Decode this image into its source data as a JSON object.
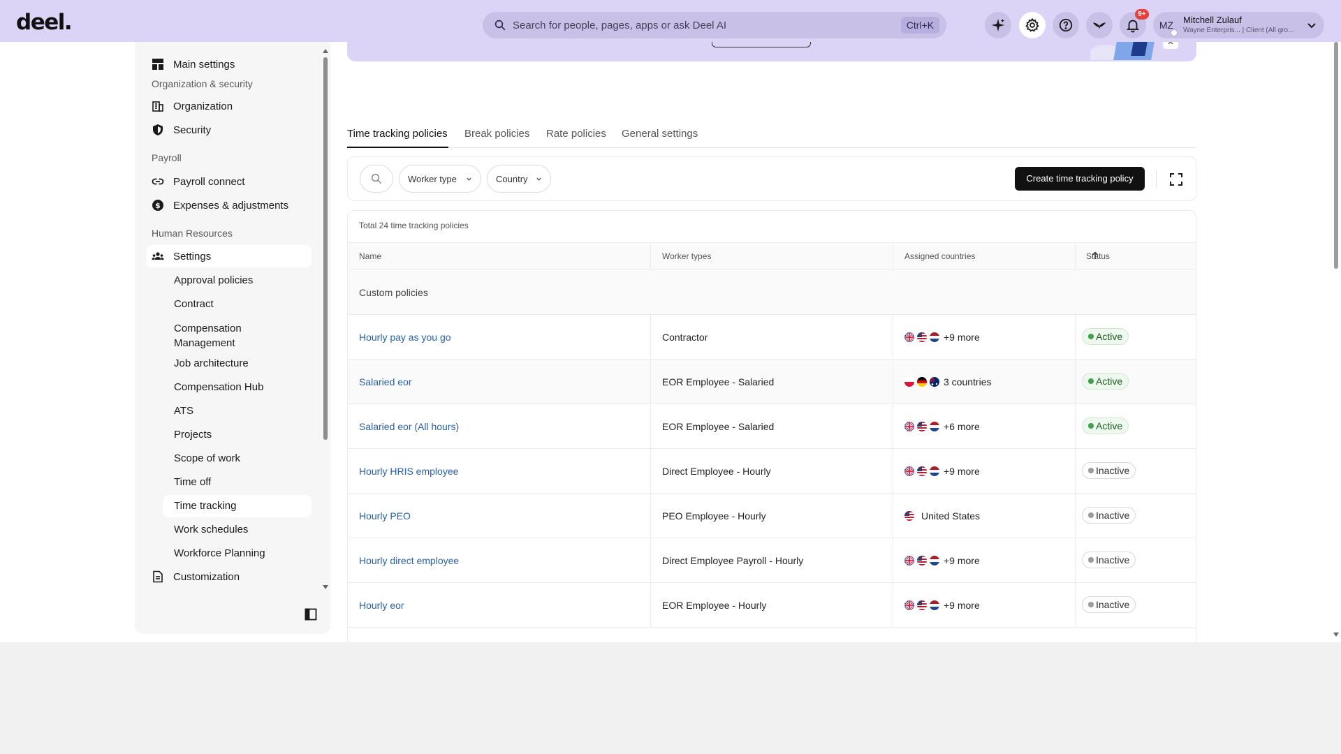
{
  "app": {
    "logo": "deel."
  },
  "search": {
    "placeholder": "Search for people, pages, apps or ask Deel AI",
    "shortcut": "Ctrl+K"
  },
  "topbar": {
    "notification_badge": "9+"
  },
  "user": {
    "initials": "MZ",
    "name": "Mitchell Zulauf",
    "org": "Wayne Enterpris... | Client (All gro..."
  },
  "sidebar": {
    "main_settings": "Main settings",
    "section_org": "Organization & security",
    "organization": "Organization",
    "security": "Security",
    "section_payroll": "Payroll",
    "payroll_connect": "Payroll connect",
    "expenses": "Expenses & adjustments",
    "section_hr": "Human Resources",
    "settings": "Settings",
    "subitems": [
      "Approval policies",
      "Contract",
      "Compensation Management",
      "Job architecture",
      "Compensation Hub",
      "ATS",
      "Projects",
      "Scope of work",
      "Time off",
      "Time tracking",
      "Work schedules",
      "Workforce Planning"
    ],
    "customization": "Customization"
  },
  "tabs": [
    "Time tracking policies",
    "Break policies",
    "Rate policies",
    "General settings"
  ],
  "filters": {
    "worker_type": "Worker type",
    "country": "Country",
    "create_button": "Create time tracking policy"
  },
  "table": {
    "total": "Total 24 time tracking policies",
    "columns": [
      "Name",
      "Worker types",
      "Assigned countries",
      "Status"
    ],
    "group": "Custom policies",
    "rows": [
      {
        "name": "Hourly pay as you go",
        "worker": "Contractor",
        "flags": [
          "gb",
          "us",
          "nl"
        ],
        "countries": "+9 more",
        "status": "Active"
      },
      {
        "name": "Salaried eor",
        "worker": "EOR Employee - Salaried",
        "flags": [
          "pl",
          "de",
          "au"
        ],
        "countries": "3 countries",
        "status": "Active"
      },
      {
        "name": "Salaried eor (All hours)",
        "worker": "EOR Employee - Salaried",
        "flags": [
          "gb",
          "us",
          "nl"
        ],
        "countries": "+6 more",
        "status": "Active"
      },
      {
        "name": "Hourly HRIS employee",
        "worker": "Direct Employee - Hourly",
        "flags": [
          "gb",
          "us",
          "nl"
        ],
        "countries": "+9 more",
        "status": "Inactive"
      },
      {
        "name": "Hourly PEO",
        "worker": "PEO Employee - Hourly",
        "flags": [
          "us"
        ],
        "countries": "United States",
        "status": "Inactive"
      },
      {
        "name": "Hourly direct employee",
        "worker": "Direct Employee Payroll - Hourly",
        "flags": [
          "gb",
          "us",
          "nl"
        ],
        "countries": "+9 more",
        "status": "Inactive"
      },
      {
        "name": "Hourly eor",
        "worker": "EOR Employee - Hourly",
        "flags": [
          "gb",
          "us",
          "nl"
        ],
        "countries": "+9 more",
        "status": "Inactive"
      }
    ]
  },
  "colors": {
    "topbar": "#dcd4f6",
    "link": "#2a61a6",
    "active": "#3fa34d",
    "primary_button": "#111111"
  }
}
